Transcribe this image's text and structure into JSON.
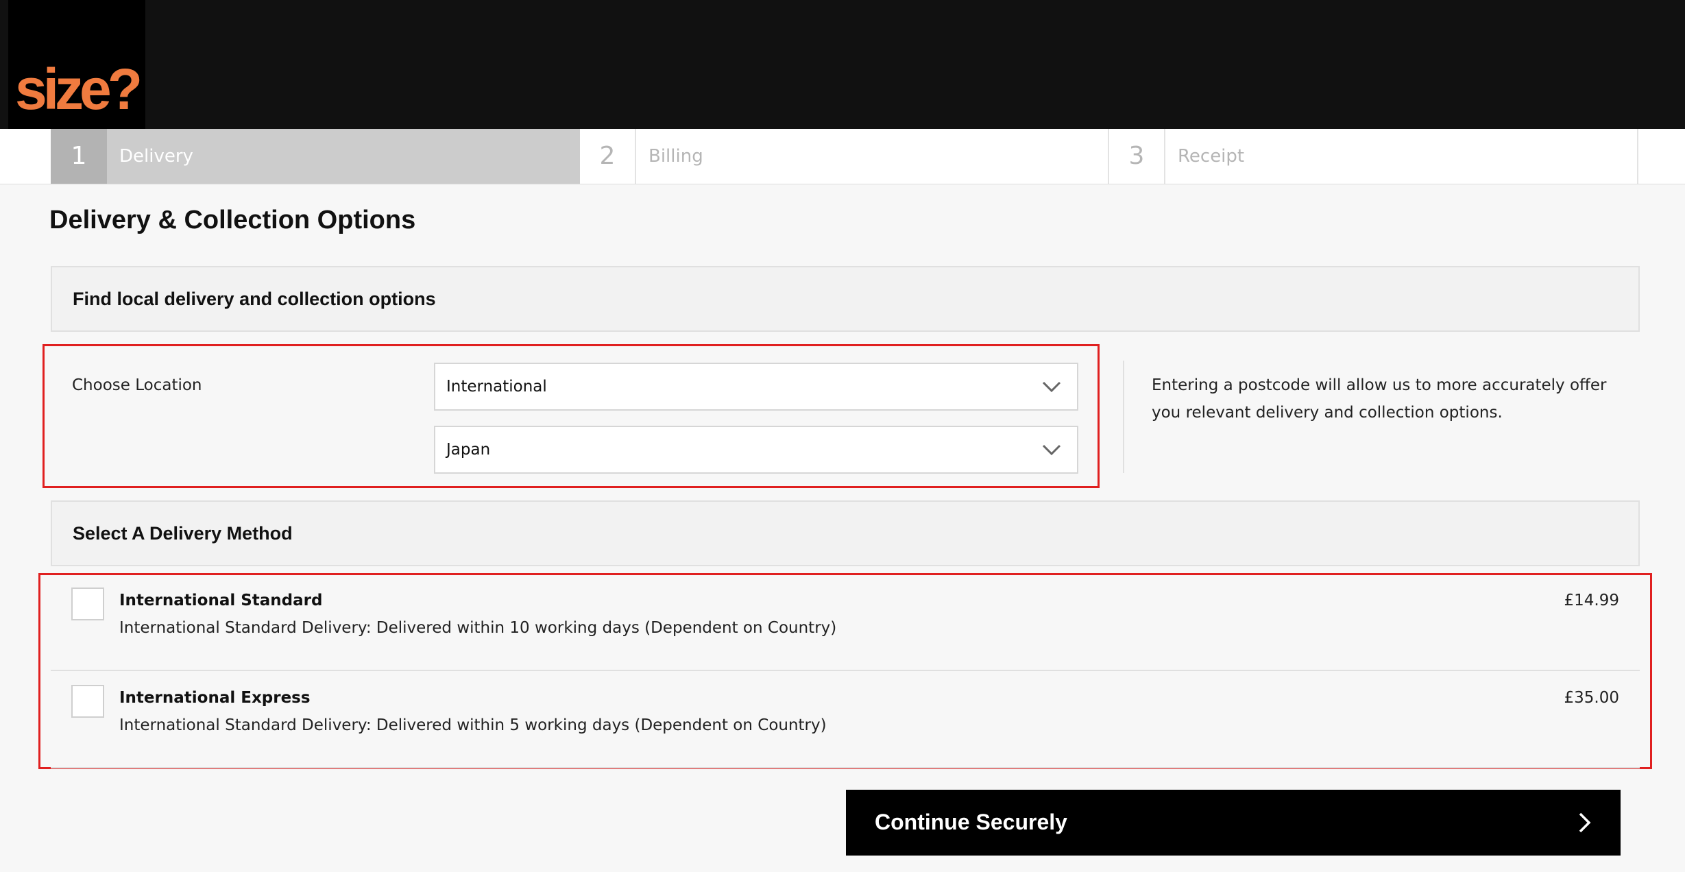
{
  "brand": {
    "logo_text": "size?",
    "logo_color": "#f07b3f"
  },
  "steps": [
    {
      "number": "1",
      "label": "Delivery",
      "active": true
    },
    {
      "number": "2",
      "label": "Billing",
      "active": false
    },
    {
      "number": "3",
      "label": "Receipt",
      "active": false
    }
  ],
  "page": {
    "title": "Delivery & Collection Options"
  },
  "location": {
    "section_title": "Find local delivery and collection options",
    "choose_label": "Choose Location",
    "region_select": {
      "value": "International"
    },
    "country_select": {
      "value": "Japan"
    },
    "info_text": "Entering a postcode will allow us to more accurately offer you relevant delivery and collection options."
  },
  "delivery": {
    "section_title": "Select A Delivery Method",
    "methods": [
      {
        "name": "International Standard",
        "description": "International Standard Delivery: Delivered within 10 working days (Dependent on Country)",
        "price": "£14.99",
        "checked": false
      },
      {
        "name": "International Express",
        "description": "International Standard Delivery: Delivered within 5 working days (Dependent on Country)",
        "price": "£35.00",
        "checked": false
      }
    ]
  },
  "actions": {
    "continue_label": "Continue Securely"
  },
  "icons": {
    "select_chevron": "chevron-down-icon",
    "continue_arrow": "chevron-right-icon"
  },
  "colors": {
    "header_bg": "#111111",
    "highlight_border": "#e02020",
    "active_step_bg": "#cccccc",
    "button_bg": "#000000"
  }
}
